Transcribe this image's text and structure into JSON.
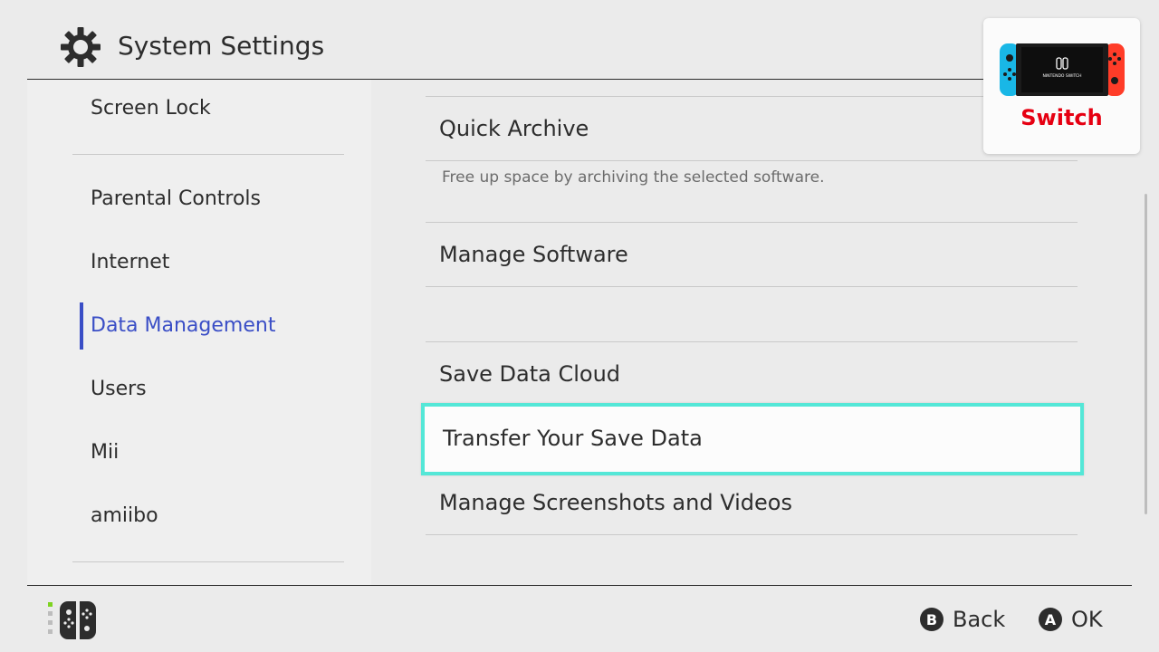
{
  "header": {
    "title": "System Settings",
    "icon": "gear-icon"
  },
  "sidebar": {
    "items": [
      {
        "label": "Screen Lock"
      },
      {
        "label": "Parental Controls"
      },
      {
        "label": "Internet"
      },
      {
        "label": "Data Management",
        "active": true
      },
      {
        "label": "Users"
      },
      {
        "label": "Mii"
      },
      {
        "label": "amiibo"
      }
    ]
  },
  "main": {
    "items": [
      {
        "label": "Quick Archive",
        "description": "Free up space by archiving the selected software."
      },
      {
        "label": "Manage Software"
      },
      {
        "label": "Save Data Cloud"
      },
      {
        "label": "Transfer Your Save Data",
        "selected": true
      },
      {
        "label": "Manage Screenshots and Videos"
      }
    ]
  },
  "device": {
    "name": "Switch",
    "name_color": "#e60012",
    "screen_logo_text": "NINTENDO SWITCH"
  },
  "footer": {
    "back": {
      "glyph": "B",
      "label": "Back"
    },
    "ok": {
      "glyph": "A",
      "label": "OK"
    }
  },
  "colors": {
    "accent": "#3a4ec6",
    "selection_border": "#54e7d7",
    "joycon_left": "#19b7e6",
    "joycon_right": "#ff3c28",
    "controller_indicator": "#7ed321"
  }
}
